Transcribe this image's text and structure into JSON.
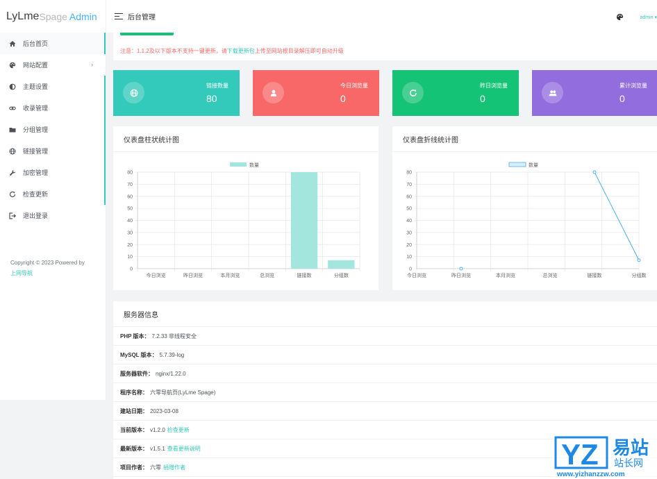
{
  "logo": {
    "part1": "LyLme",
    "part2": "Spage",
    "part3": "Admin"
  },
  "topbar": {
    "title": "后台管理",
    "user": "admin"
  },
  "sidebar": {
    "items": [
      {
        "label": "后台首页",
        "icon": "home-icon"
      },
      {
        "label": "网站配置",
        "icon": "palette-icon"
      },
      {
        "label": "主题设置",
        "icon": "contrast-icon"
      },
      {
        "label": "收录管理",
        "icon": "link-icon"
      },
      {
        "label": "分组管理",
        "icon": "folder-icon"
      },
      {
        "label": "链接管理",
        "icon": "globe-icon"
      },
      {
        "label": "加密管理",
        "icon": "wrench-icon"
      },
      {
        "label": "检查更新",
        "icon": "refresh-icon"
      },
      {
        "label": "退出登录",
        "icon": "logout-icon"
      }
    ],
    "copyright": "Copyright © 2023 Powered by",
    "copyright_link": "上网导航"
  },
  "notice": {
    "prefix": "注意：1.1.2及以下版本不支持一键更新，请",
    "link": "下载更新包",
    "suffix": "上传至网站根目录解压即可自动升级"
  },
  "stats": [
    {
      "label": "链接数量",
      "value": "80",
      "color": "#33cabb",
      "icon": "globe-icon"
    },
    {
      "label": "今日浏览量",
      "value": "0",
      "color": "#f96868",
      "icon": "user-icon"
    },
    {
      "label": "昨日浏览量",
      "value": "0",
      "color": "#15c377",
      "icon": "sync-icon"
    },
    {
      "label": "累计浏览量",
      "value": "0",
      "color": "#926dde",
      "icon": "users-icon"
    }
  ],
  "panels": {
    "bar_title": "仪表盘柱状统计图",
    "line_title": "仪表盘折线统计图",
    "server_title": "服务器信息"
  },
  "chart_data": [
    {
      "type": "bar",
      "categories": [
        "今日浏览",
        "昨日浏览",
        "本月浏览",
        "总浏览",
        "链接数",
        "分组数"
      ],
      "series": [
        {
          "name": "数量",
          "values": [
            0,
            0,
            0,
            0,
            80,
            7
          ]
        }
      ],
      "ylim": [
        0,
        80
      ],
      "yticks": [
        0,
        10,
        20,
        30,
        40,
        50,
        60,
        70,
        80
      ],
      "legend": "top-center",
      "colors": {
        "fill": "#a3e6de"
      }
    },
    {
      "type": "line",
      "categories": [
        "今日浏览",
        "昨日浏览",
        "本月浏览",
        "总浏览",
        "链接数",
        "分组数"
      ],
      "series": [
        {
          "name": "数量",
          "values": [
            null,
            0,
            null,
            null,
            80,
            7
          ]
        }
      ],
      "ylim": [
        0,
        80
      ],
      "yticks": [
        0,
        10,
        20,
        30,
        40,
        50,
        60,
        70,
        80
      ],
      "legend": "top-center",
      "colors": {
        "line": "#48b0f7",
        "legend_fill": "#dbeefd"
      }
    }
  ],
  "server": [
    {
      "label": "PHP 版本：",
      "value": "7.2.33 非线程安全",
      "link": ""
    },
    {
      "label": "MySQL 版本：",
      "value": "5.7.39-log",
      "link": ""
    },
    {
      "label": "服务器软件：",
      "value": "nginx/1.22.0",
      "link": ""
    },
    {
      "label": "程序名称：",
      "value": "六零导航页(LyLme Spage)",
      "link": ""
    },
    {
      "label": "建站日期：",
      "value": "2023-03-08",
      "link": ""
    },
    {
      "label": "当前版本：",
      "value": "v1.2.0",
      "link": "检查更新"
    },
    {
      "label": "最新版本：",
      "value": "v1.5.1",
      "link": "查看更新说明"
    },
    {
      "label": "项目作者：",
      "value": "六零",
      "link": "捐赠作者"
    }
  ],
  "watermark": {
    "letters": "YZ",
    "cn": "易站",
    "cn_sub": "站长网",
    "url": "www.yizhanzzw.com"
  }
}
